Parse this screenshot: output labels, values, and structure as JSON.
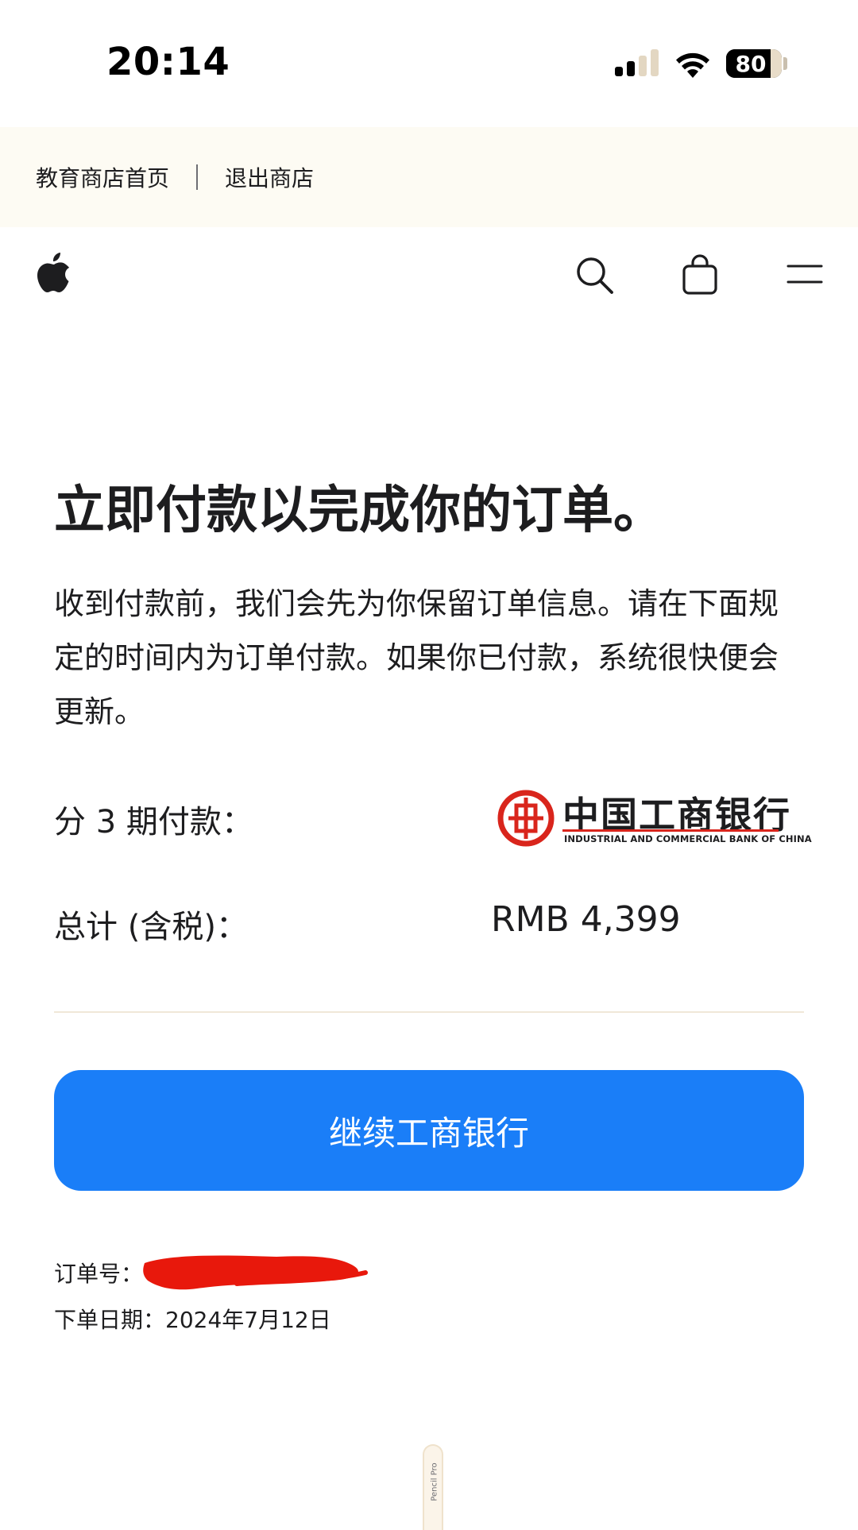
{
  "status_bar": {
    "time": "20:14",
    "battery_percent": 80,
    "battery_label": "80",
    "signal_bars_active": 2,
    "signal_bars_total": 4
  },
  "edu_bar": {
    "home_link": "教育商店首页",
    "exit_link": "退出商店"
  },
  "nav": {
    "icons": [
      "apple-logo-icon",
      "search-icon",
      "shopping-bag-icon",
      "menu-icon"
    ]
  },
  "main": {
    "title": "立即付款以完成你的订单。",
    "description": "收到付款前，我们会先为你保留订单信息。请在下面规定的时间内为订单付款。如果你已付款，系统很快便会更新。",
    "installments_label": "分 3 期付款：",
    "bank_name_cn": "中国工商银行",
    "bank_name_en": "INDUSTRIAL AND COMMERCIAL BANK OF CHINA",
    "total_label": "总计 (含税)：",
    "total_value": "RMB 4,399",
    "cta_label": "继续工商银行",
    "order_number_label": "订单号：",
    "order_date_label": "下单日期：",
    "order_date": "2024年7月12日"
  },
  "accessory": {
    "pencil_text": "Pencil Pro"
  },
  "colors": {
    "cta_blue": "#1a7ef8",
    "ribbon_bg": "#fdfbf3",
    "icbc_red": "#d9251c",
    "redaction_red": "#e8180c"
  }
}
